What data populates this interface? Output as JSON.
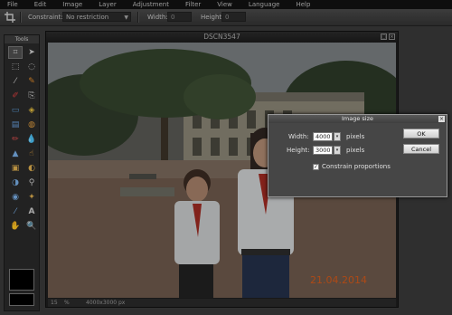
{
  "menu": [
    "File",
    "Edit",
    "Image",
    "Layer",
    "Adjustment",
    "Filter",
    "View",
    "Language",
    "Help"
  ],
  "options": {
    "constraint_label": "Constraint:",
    "constraint_value": "No restriction",
    "width_label": "Width:",
    "width_value": "0",
    "height_label": "Height:",
    "height_value": "0"
  },
  "tools_panel": {
    "title": "Tools"
  },
  "document": {
    "title": "DSCN3547",
    "zoom": "15",
    "zoom_unit": "%",
    "dimensions": "4000x3000 px",
    "photo_date_stamp": "21.04.2014"
  },
  "dialog": {
    "title": "Image size",
    "width_label": "Width:",
    "width_value": "4000",
    "height_label": "Height:",
    "height_value": "3000",
    "unit": "pixels",
    "constrain_label": "Constrain proportions",
    "constrain_checked": true,
    "ok_label": "OK",
    "cancel_label": "Cancel"
  },
  "colors": {
    "background": "#3a3a3a",
    "menubar": "#121212",
    "dialog": "#464646",
    "date_stamp": "#d35a1c"
  }
}
